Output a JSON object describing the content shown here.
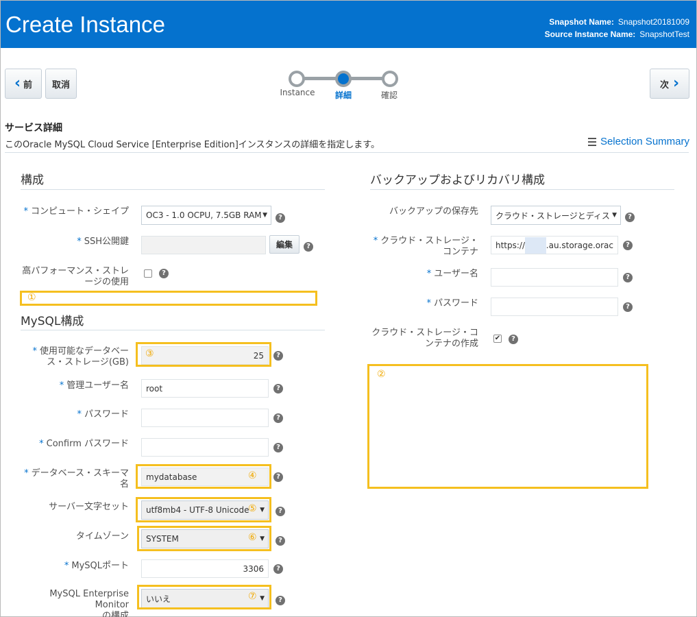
{
  "header": {
    "title": "Create Instance",
    "snapshot_label": "Snapshot Name:",
    "snapshot_value": "Snapshot20181009",
    "source_label": "Source Instance Name:",
    "source_value": "SnapshotTest"
  },
  "nav": {
    "back_label": "前",
    "cancel_label": "取消",
    "next_label": "次"
  },
  "train": {
    "steps": [
      {
        "label": "Instance",
        "state": "visited"
      },
      {
        "label": "詳細",
        "state": "current"
      },
      {
        "label": "確認",
        "state": "unvisited"
      }
    ]
  },
  "page": {
    "title": "サービス詳細",
    "description": "このOracle MySQL Cloud Service [Enterprise Edition]インスタンスの詳細を指定します。",
    "selection_summary": "Selection Summary"
  },
  "config": {
    "title": "構成",
    "compute_label": "コンピュート・シェイプ",
    "compute_value": "OC3 - 1.0 OCPU, 7.5GB RAM",
    "ssh_label": "SSH公開鍵",
    "ssh_value": "",
    "edit_label": "編集",
    "highperf_label_1": "高パフォーマンス・ストレ",
    "highperf_label_2": "ージの使用",
    "highperf_checked": false
  },
  "mysql": {
    "title": "MySQL構成",
    "storage_label_1": "使用可能なデータベー",
    "storage_label_2": "ス・ストレージ(GB)",
    "storage_value": "25",
    "admin_label": "管理ユーザー名",
    "admin_value": "root",
    "password_label": "パスワード",
    "confirm_label": "Confirm パスワード",
    "schema_label_1": "データベース・スキーマ",
    "schema_label_2": "名",
    "schema_value": "mydatabase",
    "charset_label": "サーバー文字セット",
    "charset_value": "utf8mb4 - UTF-8 Unicode",
    "timezone_label": "タイムゾーン",
    "timezone_value": "SYSTEM",
    "port_label": "MySQLポート",
    "port_value": "3306",
    "monitor_label_1": "MySQL Enterprise Monitor",
    "monitor_label_2": "の構成",
    "monitor_value": "いいえ"
  },
  "backup": {
    "title": "バックアップおよびリカバリ構成",
    "dest_label": "バックアップの保存先",
    "dest_value": "クラウド・ストレージとディス",
    "container_label_1": "クラウド・ストレージ・",
    "container_label_2": "コンテナ",
    "container_value_prefix": "https://",
    "container_value_suffix": ".au.storage.orac",
    "user_label": "ユーザー名",
    "password_label": "パスワード",
    "create_label_1": "クラウド・ストレージ・コ",
    "create_label_2": "ンテナの作成",
    "create_checked": true
  },
  "markers": {
    "m1": "①",
    "m2": "②",
    "m3": "③",
    "m4": "④",
    "m5": "⑤",
    "m6": "⑥",
    "m7": "⑦"
  },
  "colors": {
    "brand": "#0572ce",
    "highlight": "#f5bf1f"
  }
}
